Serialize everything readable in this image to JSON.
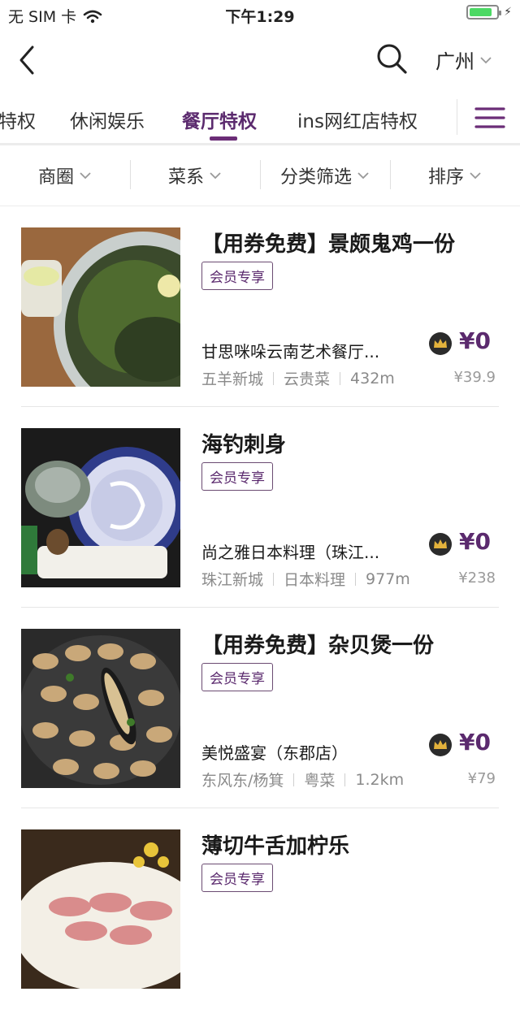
{
  "status_bar": {
    "carrier": "无 SIM 卡",
    "time": "下午1:29",
    "battery_level": 0.85
  },
  "nav": {
    "back_icon": "chevron-left-icon",
    "search_icon": "search-icon",
    "city": "广州"
  },
  "tabs": {
    "items": [
      {
        "label": "特权"
      },
      {
        "label": "休闲娱乐"
      },
      {
        "label": "餐厅特权",
        "active": true
      },
      {
        "label": "ins网红店特权"
      }
    ],
    "accent_color": "#6b2d77",
    "menu_icon": "hamburger-menu-icon"
  },
  "filters": [
    {
      "label": "商圈"
    },
    {
      "label": "菜系"
    },
    {
      "label": "分类筛选"
    },
    {
      "label": "排序"
    }
  ],
  "items": [
    {
      "title": "【用券免费】景颇鬼鸡一份",
      "badge": "会员专享",
      "shop": "甘思咪哚云南艺术餐厅...",
      "area": "五羊新城",
      "cuisine": "云贵菜",
      "distance": "432m",
      "price": "¥0",
      "orig_price": "¥39.9"
    },
    {
      "title": "海钓刺身",
      "badge": "会员专享",
      "shop": "尚之雅日本料理（珠江...",
      "area": "珠江新城",
      "cuisine": "日本料理",
      "distance": "977m",
      "price": "¥0",
      "orig_price": "¥238"
    },
    {
      "title": "【用券免费】杂贝煲一份",
      "badge": "会员专享",
      "shop": "美悦盛宴（东郡店）",
      "area": "东风东/杨箕",
      "cuisine": "粤菜",
      "distance": "1.2km",
      "price": "¥0",
      "orig_price": "¥79"
    },
    {
      "title": "薄切牛舌加柠乐",
      "badge": "会员专享"
    }
  ]
}
